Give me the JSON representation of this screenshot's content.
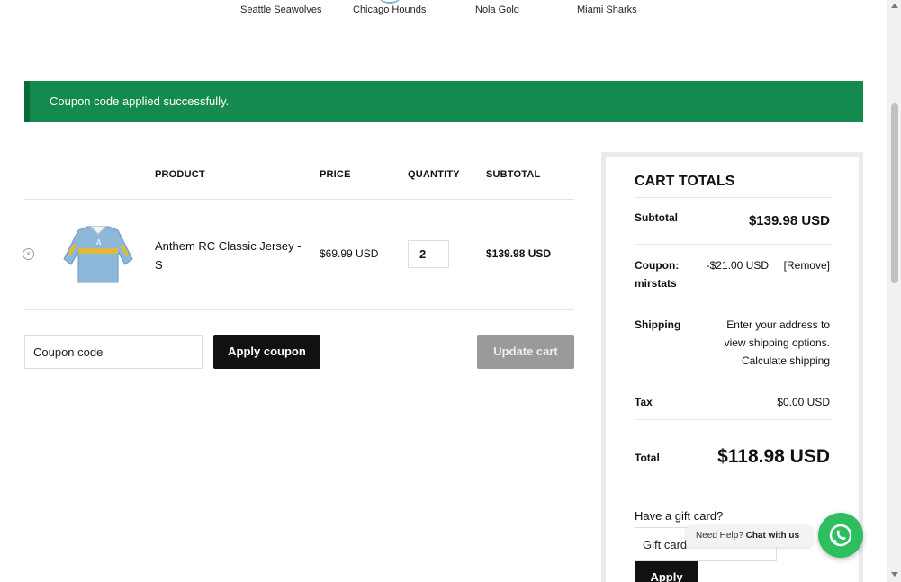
{
  "teams": [
    "Seattle Seawolves",
    "Chicago Hounds",
    "Nola Gold",
    "Miami Sharks"
  ],
  "notice": "Coupon code applied successfully.",
  "table": {
    "headers": {
      "product": "PRODUCT",
      "price": "PRICE",
      "quantity": "QUANTITY",
      "subtotal": "SUBTOTAL"
    },
    "rows": [
      {
        "name": "Anthem RC Classic Jersey - S",
        "price": "$69.99 USD",
        "quantity": "2",
        "subtotal": "$139.98 USD"
      }
    ]
  },
  "coupon": {
    "placeholder": "Coupon code",
    "apply_label": "Apply coupon",
    "update_label": "Update cart"
  },
  "totals": {
    "title": "CART TOTALS",
    "subtotal_label": "Subtotal",
    "subtotal_value": "$139.98 USD",
    "coupon_label_1": "Coupon:",
    "coupon_label_2": "mirstats",
    "coupon_value": "-$21.00 USD",
    "coupon_remove": "[Remove]",
    "shipping_label": "Shipping",
    "shipping_line1": "Enter your address to",
    "shipping_line2": "view shipping options.",
    "shipping_link": "Calculate shipping",
    "tax_label": "Tax",
    "tax_value": "$0.00 USD",
    "total_label": "Total",
    "total_value": "$118.98 USD",
    "gift_question": "Have a gift card?",
    "gift_placeholder": "Gift card",
    "gift_apply": "Apply"
  },
  "chat": {
    "prefix": "Need Help?",
    "link": "Chat with us"
  },
  "colors": {
    "success": "#148a4f",
    "button_dark": "#111111",
    "button_disabled": "#9a9a9a",
    "whatsapp": "#2dbe60"
  }
}
